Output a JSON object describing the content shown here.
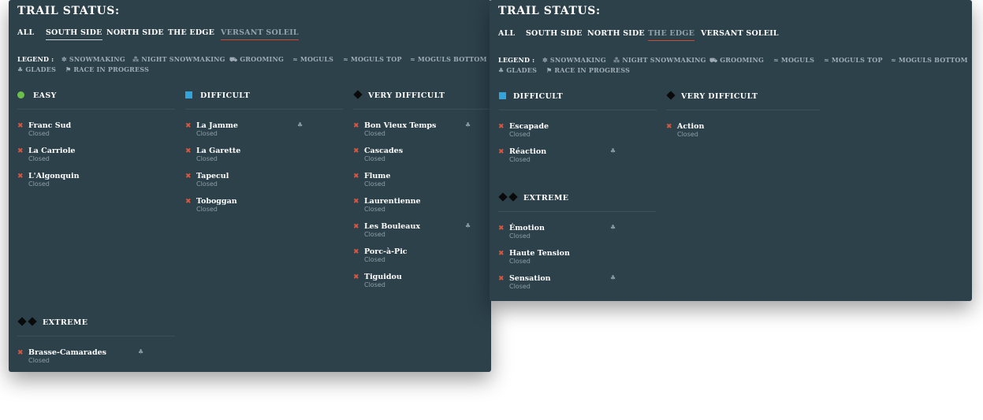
{
  "colors": {
    "panel": "#2d414b",
    "closed_x": "#d9563f",
    "easy": "#6cc04a",
    "difficult": "#33a3dc",
    "active_underline": "#d04a33"
  },
  "panel_a": {
    "title": "TRAIL STATUS:",
    "tabs": [
      "ALL",
      "SOUTH SIDE",
      "NORTH SIDE",
      "THE EDGE",
      "VERSANT SOLEIL"
    ],
    "legend": {
      "label": "LEGEND :",
      "items": [
        "SNOWMAKING",
        "NIGHT SNOWMAKING",
        "GROOMING",
        "MOGULS",
        "MOGULS TOP",
        "MOGULS BOTTOM",
        "GLADES",
        "RACE IN PROGRESS"
      ]
    },
    "easy": {
      "title": "EASY",
      "trails": [
        {
          "name": "Franc Sud",
          "status": "Closed"
        },
        {
          "name": "La Carriole",
          "status": "Closed"
        },
        {
          "name": "L'Algonquin",
          "status": "Closed"
        }
      ]
    },
    "difficult": {
      "title": "DIFFICULT",
      "trails": [
        {
          "name": "La Jamme",
          "status": "Closed",
          "icon": "glades-icon"
        },
        {
          "name": "La Garette",
          "status": "Closed"
        },
        {
          "name": "Tapecul",
          "status": "Closed"
        },
        {
          "name": "Toboggan",
          "status": "Closed"
        }
      ]
    },
    "very_difficult": {
      "title": "VERY DIFFICULT",
      "trails": [
        {
          "name": "Bon Vieux Temps",
          "status": "Closed",
          "icon": "glades-icon"
        },
        {
          "name": "Cascades",
          "status": "Closed"
        },
        {
          "name": "Flume",
          "status": "Closed"
        },
        {
          "name": "Laurentienne",
          "status": "Closed"
        },
        {
          "name": "Les Bouleaux",
          "status": "Closed",
          "icon": "glades-icon"
        },
        {
          "name": "Porc-à-Pic",
          "status": "Closed"
        },
        {
          "name": "Tiguidou",
          "status": "Closed"
        }
      ]
    },
    "extreme": {
      "title": "EXTREME",
      "trails": [
        {
          "name": "Brasse-Camarades",
          "status": "Closed",
          "icon": "glades-icon"
        }
      ]
    }
  },
  "panel_b": {
    "title": "TRAIL STATUS:",
    "tabs": [
      "ALL",
      "SOUTH SIDE",
      "NORTH SIDE",
      "THE EDGE",
      "VERSANT SOLEIL"
    ],
    "legend": {
      "label": "LEGEND :",
      "items": [
        "SNOWMAKING",
        "NIGHT SNOWMAKING",
        "GROOMING",
        "MOGULS",
        "MOGULS TOP",
        "MOGULS BOTTOM",
        "GLADES",
        "RACE IN PROGRESS"
      ]
    },
    "difficult": {
      "title": "DIFFICULT",
      "trails": [
        {
          "name": "Escapade",
          "status": "Closed"
        },
        {
          "name": "Réaction",
          "status": "Closed",
          "icon": "glades-icon"
        }
      ]
    },
    "very_difficult": {
      "title": "VERY DIFFICULT",
      "trails": [
        {
          "name": "Action",
          "status": "Closed"
        }
      ]
    },
    "extreme": {
      "title": "EXTREME",
      "trails": [
        {
          "name": "Émotion",
          "status": "Closed",
          "icon": "glades-icon"
        },
        {
          "name": "Haute Tension",
          "status": "Closed"
        },
        {
          "name": "Sensation",
          "status": "Closed",
          "icon": "glades-icon"
        }
      ]
    }
  }
}
